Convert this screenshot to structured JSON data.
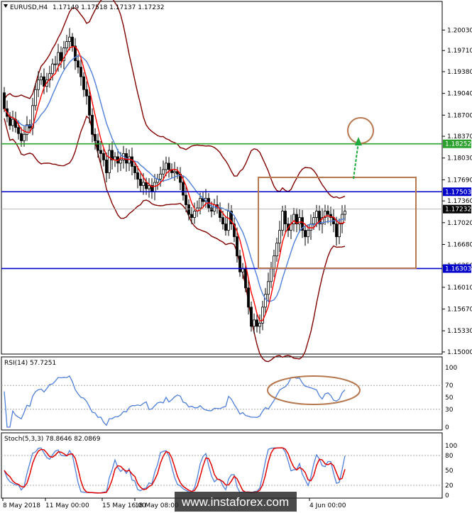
{
  "chart_data": {
    "type": "candlestick",
    "instrument_label": "EURUSD,H4",
    "ohlc_header": "1.17149 1.17518 1.17137 1.17232",
    "price_ticks": [
      "1.20030",
      "1.19710",
      "1.19380",
      "1.19040",
      "1.18700",
      "1.18370",
      "1.18030",
      "1.17690",
      "1.17360",
      "1.17020",
      "1.16680",
      "1.16350",
      "1.16010",
      "1.15670",
      "1.15330",
      "1.15000"
    ],
    "ylim": [
      1.15,
      1.203
    ],
    "levels": [
      {
        "label": "1.18252",
        "value": 1.18252,
        "color": "#2ca02c"
      },
      {
        "label": "1.17503",
        "value": 1.17503,
        "color": "#0000c8"
      },
      {
        "label": "1.16303",
        "value": 1.16303,
        "color": "#0000c8"
      }
    ],
    "current_price": {
      "label": "1.17232",
      "value": 1.17232
    },
    "date_labels": [
      "8 May 2018",
      "11 May 00:00",
      "15 May 16:00",
      "18 May 08:00",
      "4 Jun 00:00"
    ],
    "close_path": [
      [
        0,
        1.1905
      ],
      [
        4,
        1.188
      ],
      [
        9,
        1.1865
      ],
      [
        13,
        1.185
      ],
      [
        17,
        1.1868
      ],
      [
        21,
        1.1845
      ],
      [
        25,
        1.184
      ],
      [
        28,
        1.183
      ],
      [
        32,
        1.184
      ],
      [
        36,
        1.1855
      ],
      [
        40,
        1.185
      ],
      [
        44,
        1.1885
      ],
      [
        48,
        1.191
      ],
      [
        52,
        1.1925
      ],
      [
        56,
        1.193
      ],
      [
        60,
        1.1915
      ],
      [
        64,
        1.1925
      ],
      [
        68,
        1.1935
      ],
      [
        72,
        1.195
      ],
      [
        76,
        1.195
      ],
      [
        80,
        1.1968
      ],
      [
        84,
        1.1955
      ],
      [
        88,
        1.1975
      ],
      [
        92,
        1.1985
      ],
      [
        96,
        1.1992
      ],
      [
        100,
        1.1978
      ],
      [
        104,
        1.1955
      ],
      [
        108,
        1.1945
      ],
      [
        112,
        1.193
      ],
      [
        116,
        1.191
      ],
      [
        120,
        1.19
      ],
      [
        124,
        1.187
      ],
      [
        128,
        1.184
      ],
      [
        132,
        1.183
      ],
      [
        136,
        1.1815
      ],
      [
        140,
        1.181
      ],
      [
        144,
        1.18
      ],
      [
        148,
        1.178
      ],
      [
        152,
        1.1815
      ],
      [
        156,
        1.18
      ],
      [
        160,
        1.1805
      ],
      [
        164,
        1.1795
      ],
      [
        168,
        1.18
      ],
      [
        172,
        1.181
      ],
      [
        176,
        1.1795
      ],
      [
        180,
        1.1805
      ],
      [
        184,
        1.179
      ],
      [
        188,
        1.178
      ],
      [
        192,
        1.177
      ],
      [
        196,
        1.176
      ],
      [
        200,
        1.1765
      ],
      [
        204,
        1.1755
      ],
      [
        208,
        1.176
      ],
      [
        212,
        1.175
      ],
      [
        216,
        1.1765
      ],
      [
        220,
        1.177
      ],
      [
        224,
        1.1778
      ],
      [
        228,
        1.1785
      ],
      [
        232,
        1.1795
      ],
      [
        236,
        1.1785
      ],
      [
        240,
        1.178
      ],
      [
        244,
        1.1782
      ],
      [
        248,
        1.1778
      ],
      [
        252,
        1.1765
      ],
      [
        256,
        1.1745
      ],
      [
        260,
        1.173
      ],
      [
        264,
        1.1715
      ],
      [
        268,
        1.171
      ],
      [
        272,
        1.172
      ],
      [
        276,
        1.1725
      ],
      [
        280,
        1.174
      ],
      [
        284,
        1.1735
      ],
      [
        288,
        1.174
      ],
      [
        292,
        1.1725
      ],
      [
        296,
        1.172
      ],
      [
        300,
        1.173
      ],
      [
        304,
        1.1725
      ],
      [
        308,
        1.171
      ],
      [
        312,
        1.17
      ],
      [
        316,
        1.169
      ],
      [
        320,
        1.172
      ],
      [
        324,
        1.17
      ],
      [
        328,
        1.168
      ],
      [
        332,
        1.165
      ],
      [
        336,
        1.1625
      ],
      [
        340,
        1.163
      ],
      [
        344,
        1.16
      ],
      [
        348,
        1.157
      ],
      [
        352,
        1.154
      ],
      [
        356,
        1.155
      ],
      [
        360,
        1.154
      ],
      [
        364,
        1.1545
      ],
      [
        368,
        1.157
      ],
      [
        372,
        1.159
      ],
      [
        376,
        1.161
      ],
      [
        380,
        1.163
      ],
      [
        384,
        1.165
      ],
      [
        388,
        1.167
      ],
      [
        392,
        1.169
      ],
      [
        396,
        1.172
      ],
      [
        400,
        1.17
      ],
      [
        404,
        1.169
      ],
      [
        408,
        1.17
      ],
      [
        412,
        1.1715
      ],
      [
        416,
        1.17
      ],
      [
        420,
        1.171
      ],
      [
        424,
        1.169
      ],
      [
        428,
        1.168
      ],
      [
        432,
        1.169
      ],
      [
        436,
        1.17
      ],
      [
        440,
        1.171
      ],
      [
        444,
        1.172
      ],
      [
        448,
        1.17
      ],
      [
        452,
        1.171
      ],
      [
        456,
        1.172
      ],
      [
        460,
        1.1715
      ],
      [
        464,
        1.171
      ],
      [
        468,
        1.17
      ],
      [
        472,
        1.168
      ],
      [
        476,
        1.17
      ],
      [
        480,
        1.1715
      ],
      [
        484,
        1.172
      ],
      [
        488,
        1.1722
      ],
      [
        491,
        1.17232
      ]
    ],
    "rsi": {
      "label": "RSI(14) 57.7251",
      "ticks": [
        "100",
        "70",
        "50",
        "30",
        "0"
      ],
      "levels": [
        70,
        30
      ],
      "ylim": [
        0,
        100
      ]
    },
    "stochastic": {
      "label": "Stoch(5,3,3) 78.8646 82.0869",
      "ticks": [
        "100",
        "80",
        "50",
        "20",
        "0"
      ],
      "levels": [
        80,
        20
      ],
      "ylim": [
        0,
        100
      ]
    }
  },
  "watermark": "www.instaforex.com",
  "colors": {
    "bands": "#800000",
    "ma_fast": "#ff0000",
    "ma_slow": "#4f7fd8",
    "indicator": "#4f7fd8",
    "signal": "#e00000",
    "box": "#b5784f",
    "arrow": "#1eaa3c"
  }
}
